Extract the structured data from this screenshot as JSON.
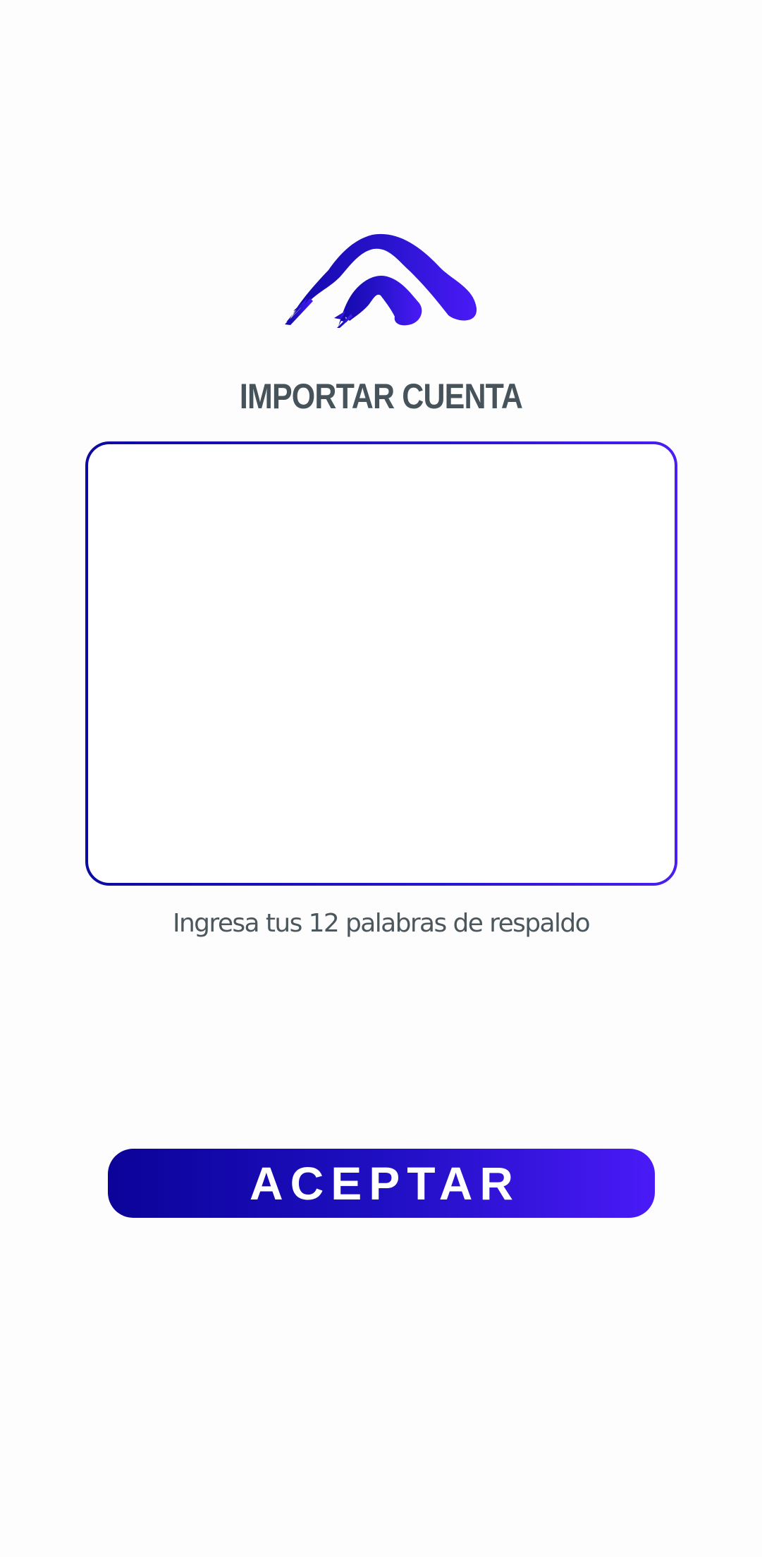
{
  "brand": {
    "logo_icon": "brush-stroke-mountain-logo",
    "gradient_start": "#1108a8",
    "gradient_end": "#4a1af7"
  },
  "header": {
    "title": "IMPORTAR CUENTA"
  },
  "seed_input": {
    "value": "",
    "placeholder": ""
  },
  "helper": {
    "text": "Ingresa tus 12 palabras de respaldo"
  },
  "actions": {
    "accept_label": "ACEPTAR"
  },
  "colors": {
    "title_text": "#47535a",
    "helper_text": "#4c575d",
    "button_text": "#ffffff",
    "background": "#fdfdfd"
  }
}
